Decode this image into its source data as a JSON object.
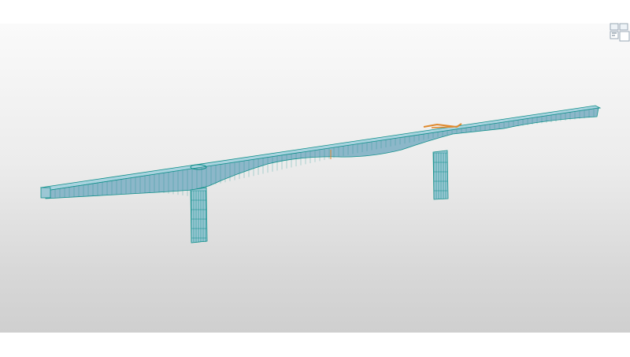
{
  "app": {
    "window": "3d-model-viewport"
  },
  "viewport": {
    "background_top": "#fafafa",
    "background_bottom": "#cfcfcf"
  },
  "model": {
    "type": "bridge",
    "deck_color": "#8cb7c9",
    "wire_color": "#0f8f8a",
    "highlight_color": "#e08a2e",
    "piers": 2
  },
  "navigation": {
    "icon": "view-cube-icon"
  }
}
